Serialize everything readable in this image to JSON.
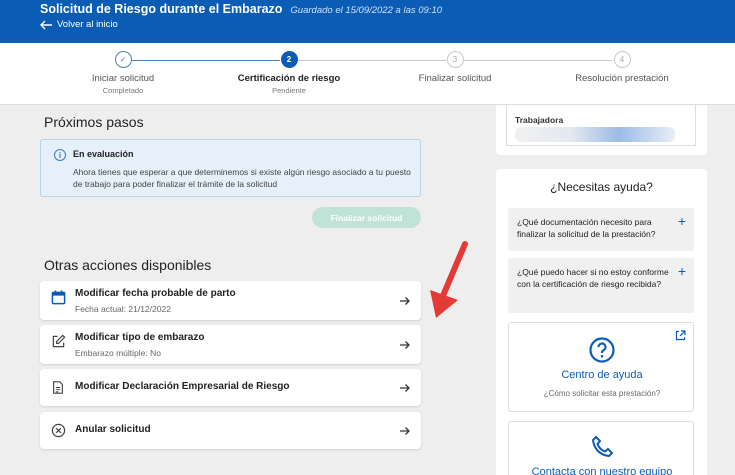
{
  "header": {
    "title": "Solicitud de Riesgo durante el Embarazo",
    "saved": "Guardado el 15/09/2022 a las 09:10",
    "back_label": "Volver al inicio"
  },
  "stepper": {
    "steps": [
      {
        "number": "✓",
        "label": "Iniciar solicitud",
        "sub": "Completado"
      },
      {
        "number": "2",
        "label": "Certificación de riesgo",
        "sub": "Pendiente"
      },
      {
        "number": "3",
        "label": "Finalizar solicitud",
        "sub": ""
      },
      {
        "number": "4",
        "label": "Resolución prestación",
        "sub": ""
      }
    ]
  },
  "next_steps": {
    "title": "Próximos pasos",
    "info_icon": "info-icon",
    "info_head": "En evaluación",
    "info_body": "Ahora tienes que esperar a que determinemos si existe algún riesgo asociado a tu puesto de trabajo para poder finalizar el trámite de la solicitud",
    "finalize_label": "Finalizar solicitud"
  },
  "other_actions": {
    "title": "Otras acciones disponibles",
    "items": [
      {
        "icon": "calendar-icon",
        "label": "Modificar fecha probable de parto",
        "sub": "Fecha actual: 21/12/2022"
      },
      {
        "icon": "edit-icon",
        "label": "Modificar tipo de embarazo",
        "sub": "Embarazo múltiple: No"
      },
      {
        "icon": "document-icon",
        "label": "Modificar Declaración Empresarial de Riesgo",
        "sub": ""
      },
      {
        "icon": "cancel-circle-icon",
        "label": "Anular solicitud",
        "sub": ""
      }
    ]
  },
  "applicant": {
    "label": "Trabajadora"
  },
  "help": {
    "title": "¿Necesitas ayuda?",
    "faqs": [
      {
        "q": "¿Qué documentación necesito para finalizar la solicitud de la prestación?"
      },
      {
        "q": "¿Qué puedo hacer si no estoy conforme con la certificación de riesgo recibida?"
      }
    ],
    "center_title": "Centro de ayuda",
    "center_sub": "¿Cómo solicitar esta prestación?",
    "contact_title": "Contacta con nuestro equipo"
  },
  "colors": {
    "brand": "#0b5cb4",
    "finalize_disabled": "#bfe3d7",
    "annotation": "#e53935"
  }
}
